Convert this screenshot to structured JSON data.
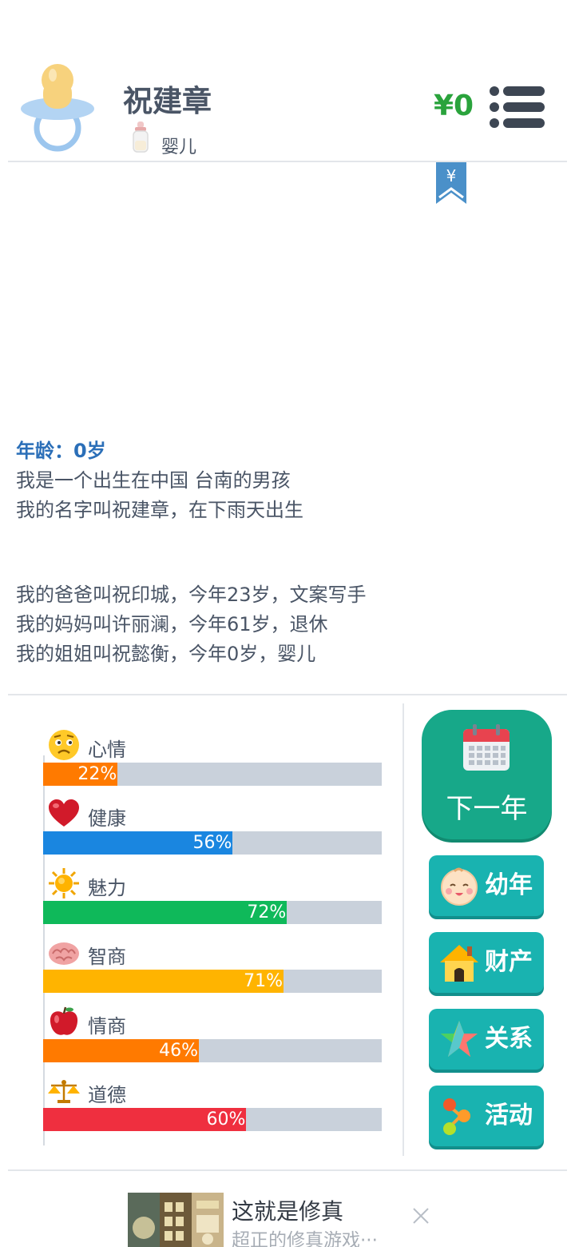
{
  "header": {
    "name": "祝建章",
    "stage": "婴儿",
    "money": "¥0",
    "bookmark_symbol": "¥"
  },
  "story": {
    "age_line": "年龄：0岁",
    "lines_1": [
      "我是一个出生在中国 台南的男孩",
      "我的名字叫祝建章，在下雨天出生"
    ],
    "lines_2": [
      "我的爸爸叫祝印城，今年23岁，文案写手",
      "我的妈妈叫许丽澜，今年61岁，退休",
      "我的姐姐叫祝懿衡，今年0岁，婴儿"
    ]
  },
  "stats": [
    {
      "label": "心情",
      "value": 22,
      "pct": "22%",
      "color": "#ff7a00",
      "icon": "worried-face-icon"
    },
    {
      "label": "健康",
      "value": 56,
      "pct": "56%",
      "color": "#1a86e0",
      "icon": "heart-icon"
    },
    {
      "label": "魅力",
      "value": 72,
      "pct": "72%",
      "color": "#0fb95a",
      "icon": "sun-icon"
    },
    {
      "label": "智商",
      "value": 71,
      "pct": "71%",
      "color": "#ffb400",
      "icon": "brain-icon"
    },
    {
      "label": "情商",
      "value": 46,
      "pct": "46%",
      "color": "#ff7a00",
      "icon": "apple-icon"
    },
    {
      "label": "道德",
      "value": 60,
      "pct": "60%",
      "color": "#ef2f3f",
      "icon": "scales-icon"
    }
  ],
  "actions": {
    "next_year": "下一年",
    "childhood": "幼年",
    "assets": "财产",
    "relations": "关系",
    "activities": "活动"
  },
  "ad": {
    "title": "这就是修真",
    "subtitle": "超正的修真游戏···"
  },
  "colors": {
    "accent_teal": "#19b3b0",
    "next_year_green": "#17a889",
    "money_green": "#2aa33c",
    "age_blue": "#2b6fb8"
  }
}
